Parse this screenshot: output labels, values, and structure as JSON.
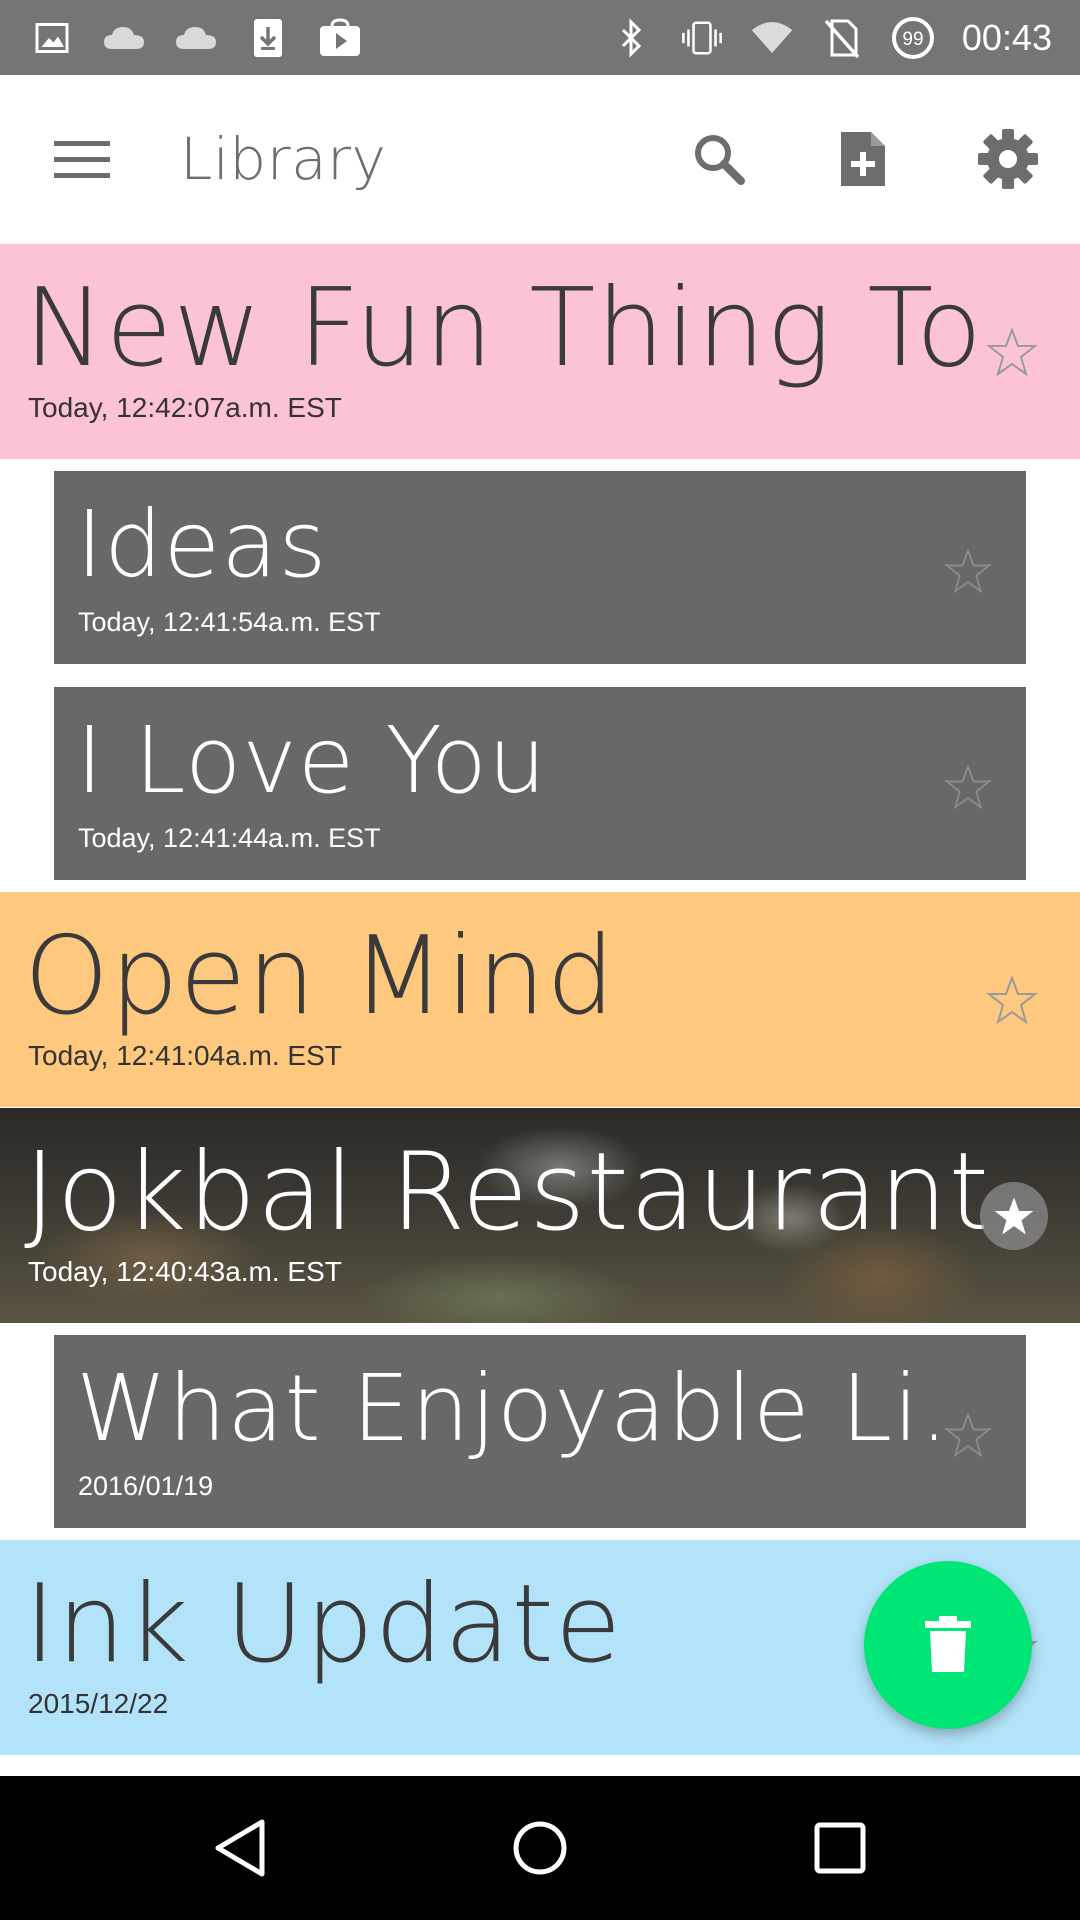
{
  "status_bar": {
    "left_icons": [
      "image-icon",
      "cloud-icon",
      "cloud-icon",
      "download-icon",
      "play-store-icon"
    ],
    "right_icons": [
      "bluetooth-icon",
      "vibrate-icon",
      "wifi-icon",
      "no-sim-icon",
      "battery-icon"
    ],
    "battery_level": "99",
    "time": "00:43"
  },
  "app_bar": {
    "title": "Library",
    "actions": [
      "search-icon",
      "new-note-icon",
      "settings-icon"
    ]
  },
  "notes": [
    {
      "title": "New Fun Thing To...",
      "date": "Today, 12:42:07a.m. EST",
      "style": "full",
      "color": "#fcc2d8",
      "starred": false
    },
    {
      "title": "Ideas",
      "date": "Today, 12:41:54a.m. EST",
      "style": "inset",
      "color": "#686868",
      "starred": false
    },
    {
      "title": "I Love You",
      "date": "Today, 12:41:44a.m. EST",
      "style": "inset",
      "color": "#686868",
      "starred": false
    },
    {
      "title": "Open Mind",
      "date": "Today, 12:41:04a.m. EST",
      "style": "full",
      "color": "#fec87f",
      "starred": false
    },
    {
      "title": "Jokbal Restaurant",
      "date": "Today, 12:40:43a.m. EST",
      "style": "full-photo",
      "color": "#3c3a32",
      "starred": true
    },
    {
      "title": "What Enjoyable Li...",
      "date": "2016/01/19",
      "style": "inset",
      "color": "#686868",
      "starred": false
    },
    {
      "title": "Ink Update",
      "date": "2015/12/22",
      "style": "full",
      "color": "#b3e3f9",
      "starred": false
    }
  ],
  "fab": {
    "icon": "trash-icon",
    "color": "#00e676"
  },
  "nav_bar": {
    "buttons": [
      "back-icon",
      "home-icon",
      "recents-icon"
    ]
  }
}
